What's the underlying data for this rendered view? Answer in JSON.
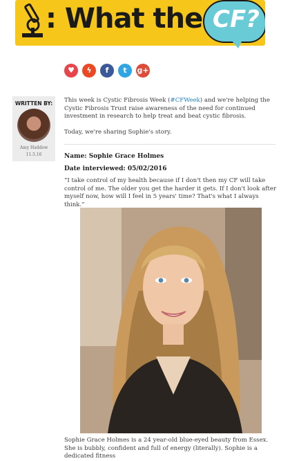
{
  "banner": {
    "title": ": What the",
    "bubble": "CF?"
  },
  "share": [
    {
      "name": "heart-icon",
      "glyph": "♥",
      "color": "#e8454a"
    },
    {
      "name": "stumbleupon-icon",
      "glyph": "ϟ",
      "color": "#eb4924"
    },
    {
      "name": "facebook-icon",
      "glyph": "f",
      "color": "#3b5998"
    },
    {
      "name": "twitter-icon",
      "glyph": "t",
      "color": "#2fa6e2"
    },
    {
      "name": "googleplus-icon",
      "glyph": "g+",
      "color": "#dd4b39"
    }
  ],
  "author": {
    "written_by": "WRITTEN BY:",
    "name": "Amy Haddow",
    "date": "11.5.16"
  },
  "article": {
    "intro_before": "This week is Cystic Fibrosis Week (",
    "intro_link": "#CFWeek",
    "intro_after": ") and we're helping the Cystic Fibrosis Trust raise awareness of the need for continued investment in research to help treat and beat cystic fibrosis.",
    "sharing": "Today, we're sharing Sophie's story.",
    "name_line": "Name: Sophie Grace Holmes",
    "date_line": "Date interviewed: 05/02/2016",
    "quote": "“I take control of my health because if I don't then my CF will take control of me. The older you get the harder it gets. If I don't look after myself now, how will I feel in 5 years' time? That's what I always think.”",
    "bio": "Sophie Grace Holmes is a 24 year-old blue-eyed beauty from Essex. She is bubbly, confident and full of energy (literally). Sophie is a dedicated fitness"
  }
}
